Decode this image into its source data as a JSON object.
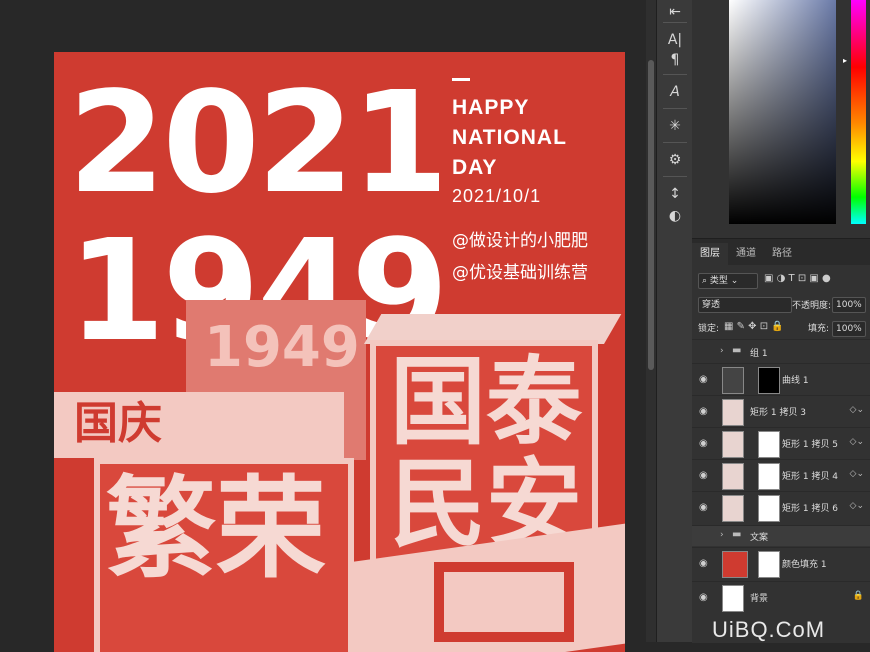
{
  "poster": {
    "year_top": "2021",
    "year_bottom": "1949",
    "eng_line1": "HAPPY",
    "eng_line2": "NATIONAL",
    "eng_line3": "DAY",
    "date": "2021/10/1",
    "handle1": "@做设计的小肥肥",
    "handle2": "@优设基础训练营",
    "cube1_front": "国泰",
    "cube1_front2": "民安",
    "cube2_front": "繁荣",
    "cube3_text": "1949",
    "cube_top_text": "国庆"
  },
  "tools": [
    "A|",
    "¶",
    "A",
    "✳",
    "⚙",
    "↕",
    "◐"
  ],
  "layers_panel": {
    "tabs": [
      "图层",
      "通道",
      "路径"
    ],
    "active_tab": "图层",
    "filter_label": "类型",
    "blend_mode": "穿透",
    "opacity_label": "不透明度:",
    "opacity_value": "100%",
    "lock_label": "锁定:",
    "fill_label": "填充:",
    "fill_value": "100%",
    "layers": [
      {
        "name": "组 1",
        "type": "group"
      },
      {
        "name": "曲线 1",
        "type": "adjust"
      },
      {
        "name": "矩形 1 拷贝 3",
        "type": "smart"
      },
      {
        "name": "矩形 1 拷贝 5",
        "type": "masked"
      },
      {
        "name": "矩形 1 拷贝 4",
        "type": "masked"
      },
      {
        "name": "矩形 1 拷贝 6",
        "type": "masked"
      },
      {
        "name": "文案",
        "type": "group"
      },
      {
        "name": "颜色填充 1",
        "type": "fill"
      },
      {
        "name": "背景",
        "type": "background"
      }
    ]
  },
  "colors": {
    "poster_red": "#cf3b30",
    "panel_bg": "#323232",
    "canvas_bg": "#282828"
  },
  "watermark": "UiBQ.CoM"
}
